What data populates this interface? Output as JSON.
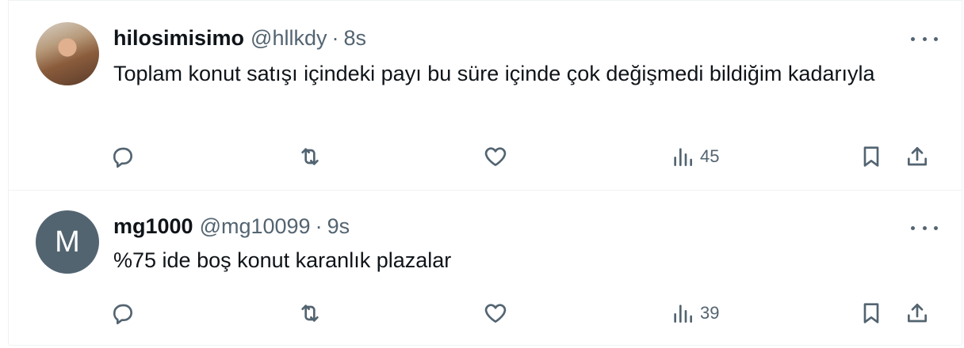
{
  "tweets": [
    {
      "author_name": "hilosimisimo",
      "handle": "@hllkdy",
      "separator": "·",
      "time": "8s",
      "text": "Toplam konut satışı içindeki payı bu süre içinde çok değişmedi bildiğim kadarıyla",
      "avatar": "photo",
      "views": "45"
    },
    {
      "author_name": "mg1000",
      "handle": "@mg10099",
      "separator": "·",
      "time": "9s",
      "text": "%75 ide boş konut karanlık plazalar",
      "avatar_initial": "M",
      "views": "39"
    }
  ],
  "icons": {
    "reply": "reply-icon",
    "retweet": "retweet-icon",
    "like": "heart-icon",
    "views": "views-icon",
    "bookmark": "bookmark-icon",
    "share": "share-icon",
    "more": "more-icon"
  },
  "colors": {
    "text_primary": "#0f1419",
    "text_secondary": "#536471",
    "border": "#eff3f4",
    "avatar_bg": "#536471"
  }
}
